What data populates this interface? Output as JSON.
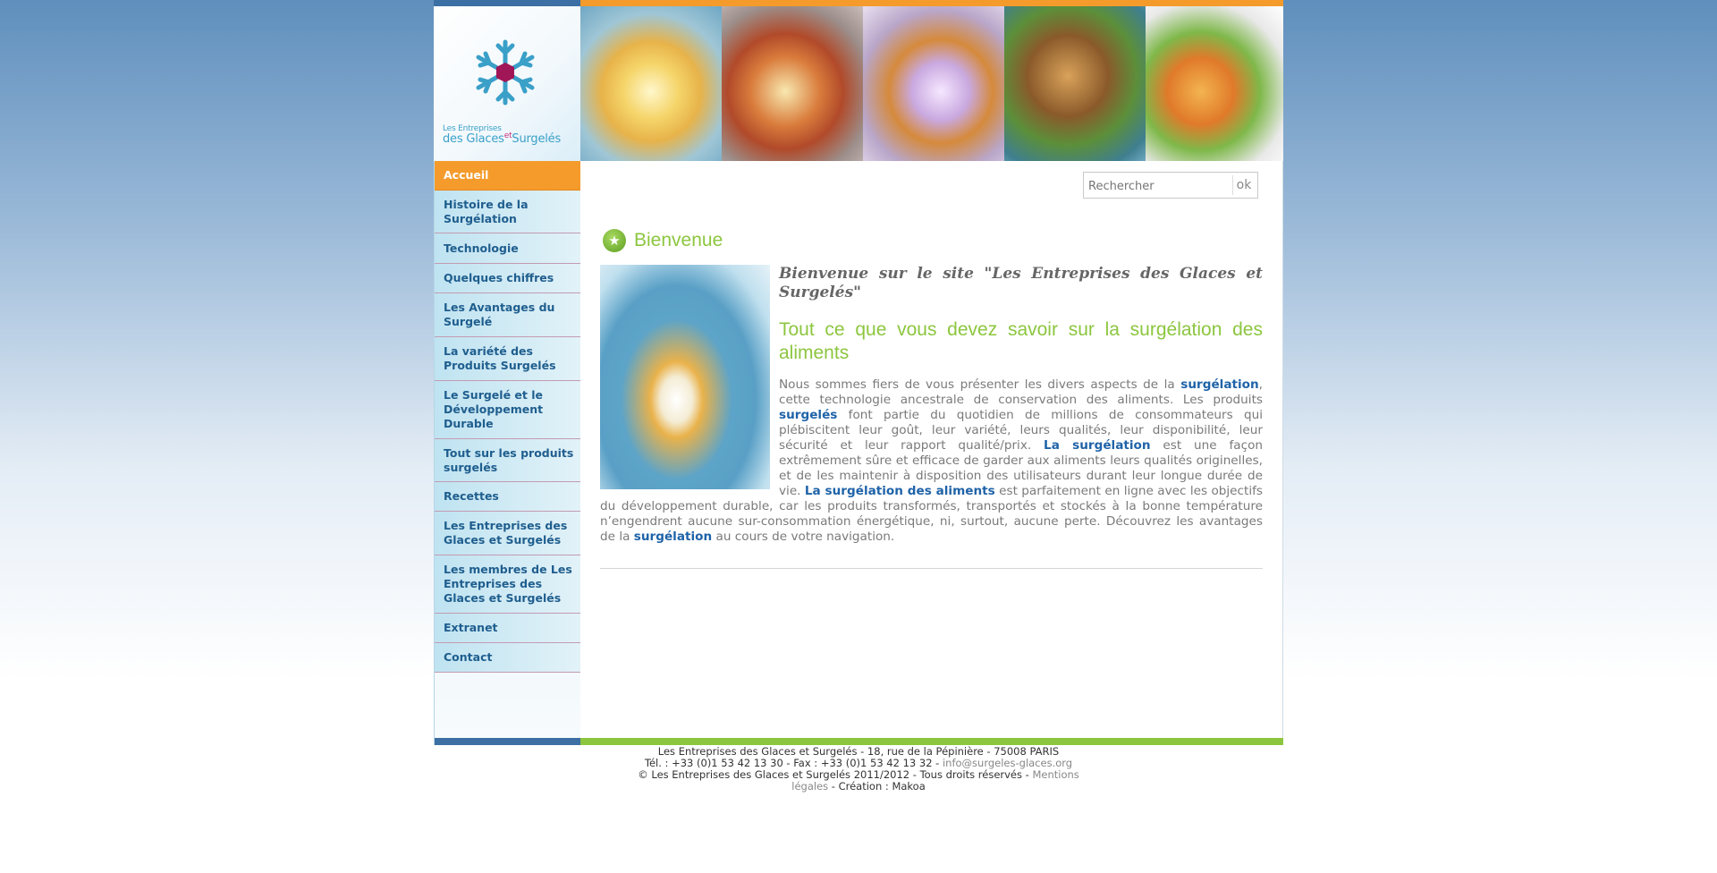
{
  "logo": {
    "line1": "Les Entreprises",
    "line2a": "des Glaces",
    "line2b": "et",
    "line2c": "Surgelés"
  },
  "menu": [
    {
      "label": "Accueil",
      "active": true
    },
    {
      "label": "Histoire de la Surgélation"
    },
    {
      "label": "Technologie"
    },
    {
      "label": "Quelques chiffres"
    },
    {
      "label": "Les Avantages du Surgelé"
    },
    {
      "label": "La variété des Produits Surgelés"
    },
    {
      "label": "Le Surgelé et le Développement Durable"
    },
    {
      "label": "Tout sur les produits surgelés"
    },
    {
      "label": "Recettes"
    },
    {
      "label": "Les Entreprises des Glaces et Surgelés"
    },
    {
      "label": "Les membres de Les Entreprises des Glaces et Surgelés"
    },
    {
      "label": "Extranet"
    },
    {
      "label": "Contact"
    }
  ],
  "search": {
    "placeholder": "Rechercher",
    "button": "ok"
  },
  "section_title": "Bienvenue",
  "article": {
    "heading": "Bienvenue sur le site \"Les Entreprises des Glaces et Surgelés\"",
    "subheading": "Tout ce que vous devez savoir sur la surgélation des aliments",
    "t1": "Nous sommes fiers de vous présenter les divers aspects de la ",
    "l1": "surgélation",
    "t2": ", cette technologie ancestrale de conservation des aliments. Les produits ",
    "l2": "surgelés",
    "t3": " font partie du quotidien de millions de consommateurs qui plébiscitent leur goût, leur variété, leurs qualités, leur disponibilité, leur sécurité et leur rapport qualité/prix. ",
    "l3": "La surgélation",
    "t4": " est une façon extrêmement sûre et efficace de garder aux aliments leurs qualités originelles, et de les maintenir à disposition des utilisateurs durant leur longue durée de vie. ",
    "l4": "La surgélation des aliments",
    "t5": " est parfaitement en ligne avec les objectifs du développement durable, car les produits transformés, transportés et stockés à la bonne température n’engendrent aucune sur-consommation énergétique, ni, surtout, aucune perte. Découvrez les avantages de la ",
    "l5": "surgélation",
    "t6": " au cours de votre navigation."
  },
  "footer": {
    "address": "Les Entreprises des Glaces et Surgelés - 18, rue de la Pépinière - 75008 PARIS",
    "phone": "Tél. : +33 (0)1 53 42 13 30 - Fax : +33 (0)1 53 42 13 32 - ",
    "email": "info@surgeles-glaces.org",
    "copyright": "© Les Entreprises des Glaces et Surgelés 2011/2012 - Tous droits réservés - ",
    "mentions_a": "Mentions",
    "mentions_b": "légales",
    "creation": " - Création : Makoa"
  },
  "colors": {
    "orange": "#f49b2c",
    "green": "#8cc63f",
    "blue_link": "#1f63a8",
    "nav_text": "#1f5e8e"
  }
}
